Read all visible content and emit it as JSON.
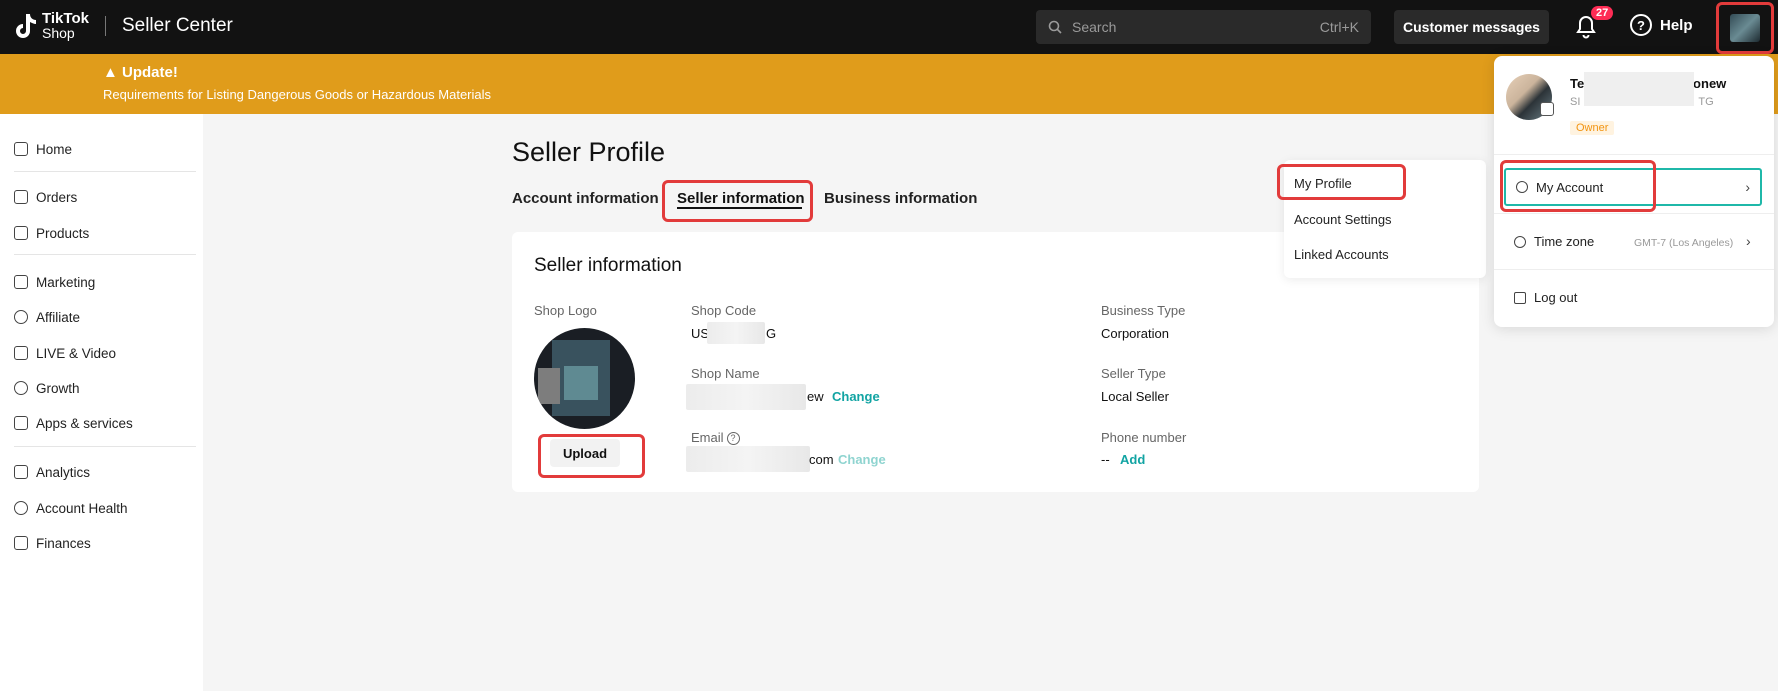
{
  "topbar": {
    "brand_line1": "TikTok",
    "brand_line2": "Shop",
    "product_name": "Seller Center",
    "search_placeholder": "Search",
    "search_shortcut": "Ctrl+K",
    "customer_messages": "Customer messages",
    "notification_count": "27",
    "help": "Help",
    "help_glyph": "?"
  },
  "banner": {
    "title": "▲ Update!",
    "message": "Requirements for Listing Dangerous Goods or Hazardous Materials"
  },
  "sidebar": {
    "items": [
      {
        "label": "Home",
        "icon": "home-icon"
      },
      {
        "label": "Orders",
        "icon": "orders-icon"
      },
      {
        "label": "Products",
        "icon": "products-icon"
      },
      {
        "label": "Marketing",
        "icon": "megaphone-icon"
      },
      {
        "label": "Affiliate",
        "icon": "affiliate-icon"
      },
      {
        "label": "LIVE & Video",
        "icon": "video-icon"
      },
      {
        "label": "Growth",
        "icon": "medal-icon"
      },
      {
        "label": "Apps & services",
        "icon": "apps-icon"
      },
      {
        "label": "Analytics",
        "icon": "analytics-icon"
      },
      {
        "label": "Account Health",
        "icon": "trophy-icon"
      },
      {
        "label": "Finances",
        "icon": "wallet-icon"
      }
    ]
  },
  "main": {
    "page_title": "Seller Profile",
    "tabs": [
      {
        "label": "Account information"
      },
      {
        "label": "Seller information"
      },
      {
        "label": "Business information"
      }
    ],
    "card_title": "Seller information",
    "shop_logo_label": "Shop Logo",
    "upload_label": "Upload",
    "shop_code_label": "Shop Code",
    "shop_code_prefix": "US",
    "shop_code_suffix": "G",
    "shop_name_label": "Shop Name",
    "shop_name_suffix": "ew",
    "email_label": "Email",
    "email_suffix": "com",
    "email_help_glyph": "?",
    "change_label": "Change",
    "business_type_label": "Business Type",
    "business_type_value": "Corporation",
    "seller_type_label": "Seller Type",
    "seller_type_value": "Local Seller",
    "phone_label": "Phone number",
    "phone_value": "--",
    "add_label": "Add"
  },
  "profile_menu": {
    "items": [
      "My Profile",
      "Account Settings",
      "Linked Accounts"
    ]
  },
  "account_dropdown": {
    "name_start": "Te",
    "name_end": "iaonew",
    "sub_start": "SI",
    "sub_end": "TG",
    "role": "Owner",
    "my_account": "My Account",
    "time_zone_label": "Time zone",
    "time_zone_value": "GMT-7 (Los Angeles)",
    "logout": "Log out",
    "chevron_glyph": "›"
  },
  "colors": {
    "topbar_bg": "#121212",
    "banner_bg": "#e09c1b",
    "link": "#12a4a3",
    "highlight": "#e23b3b",
    "badge": "#fe2c55",
    "owner_tag": "#f29411"
  }
}
